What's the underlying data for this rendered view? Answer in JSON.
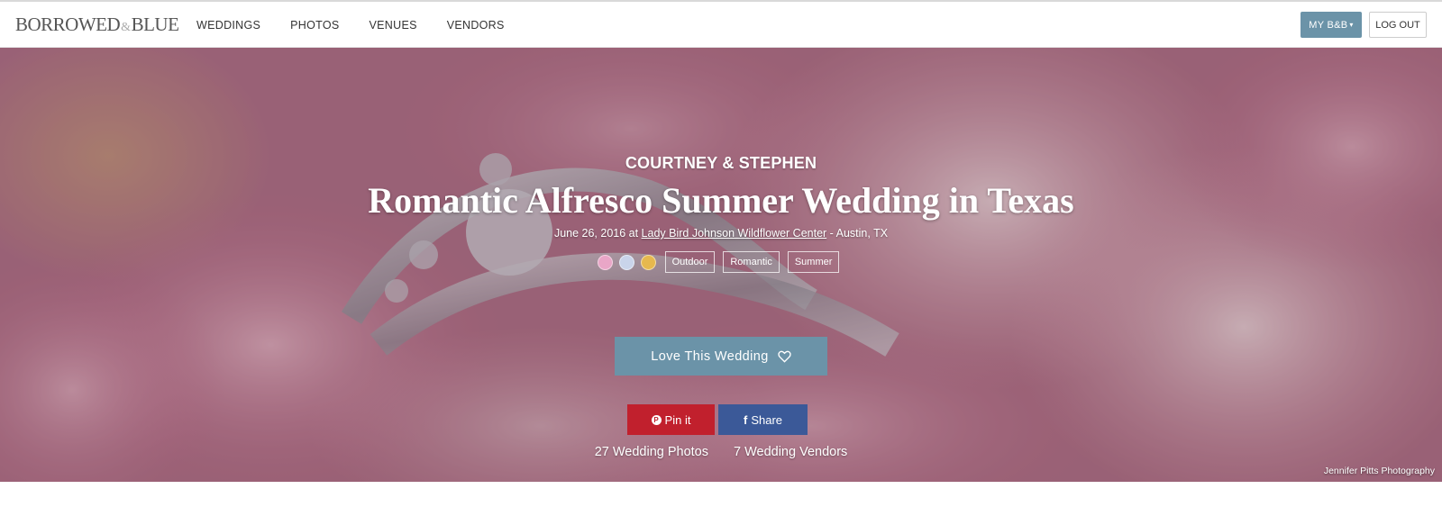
{
  "header": {
    "logo": {
      "part1": "BORROWED",
      "amp": "&",
      "part2": "BLUE"
    },
    "nav": [
      "WEDDINGS",
      "PHOTOS",
      "VENUES",
      "VENDORS"
    ],
    "my_account_label": "MY B&B",
    "logout_label": "LOG OUT"
  },
  "hero": {
    "couple": "COURTNEY & STEPHEN",
    "title": "Romantic Alfresco Summer Wedding in Texas",
    "date_prefix": "June 26, 2016 at ",
    "venue": "Lady Bird Johnson Wildflower Center",
    "location_suffix": " - Austin, TX",
    "color_swatches": [
      "#e9a6c7",
      "#c9d4ea",
      "#e6b84e"
    ],
    "tags": [
      "Outdoor",
      "Romantic",
      "Summer"
    ],
    "love_button_label": "Love This Wedding",
    "pin_label": "Pin it",
    "share_label": "Share",
    "photos_count_label": "27 Wedding Photos",
    "vendors_count_label": "7 Wedding Vendors",
    "photo_credit": "Jennifer Pitts Photography"
  },
  "colors": {
    "accent": "#6b93a8",
    "pinterest": "#c1202d",
    "facebook": "#3b5998"
  },
  "icons": {
    "love": "heart-outline-icon",
    "pin": "pinterest-icon",
    "share": "facebook-icon",
    "dropdown": "chevron-down-icon"
  }
}
